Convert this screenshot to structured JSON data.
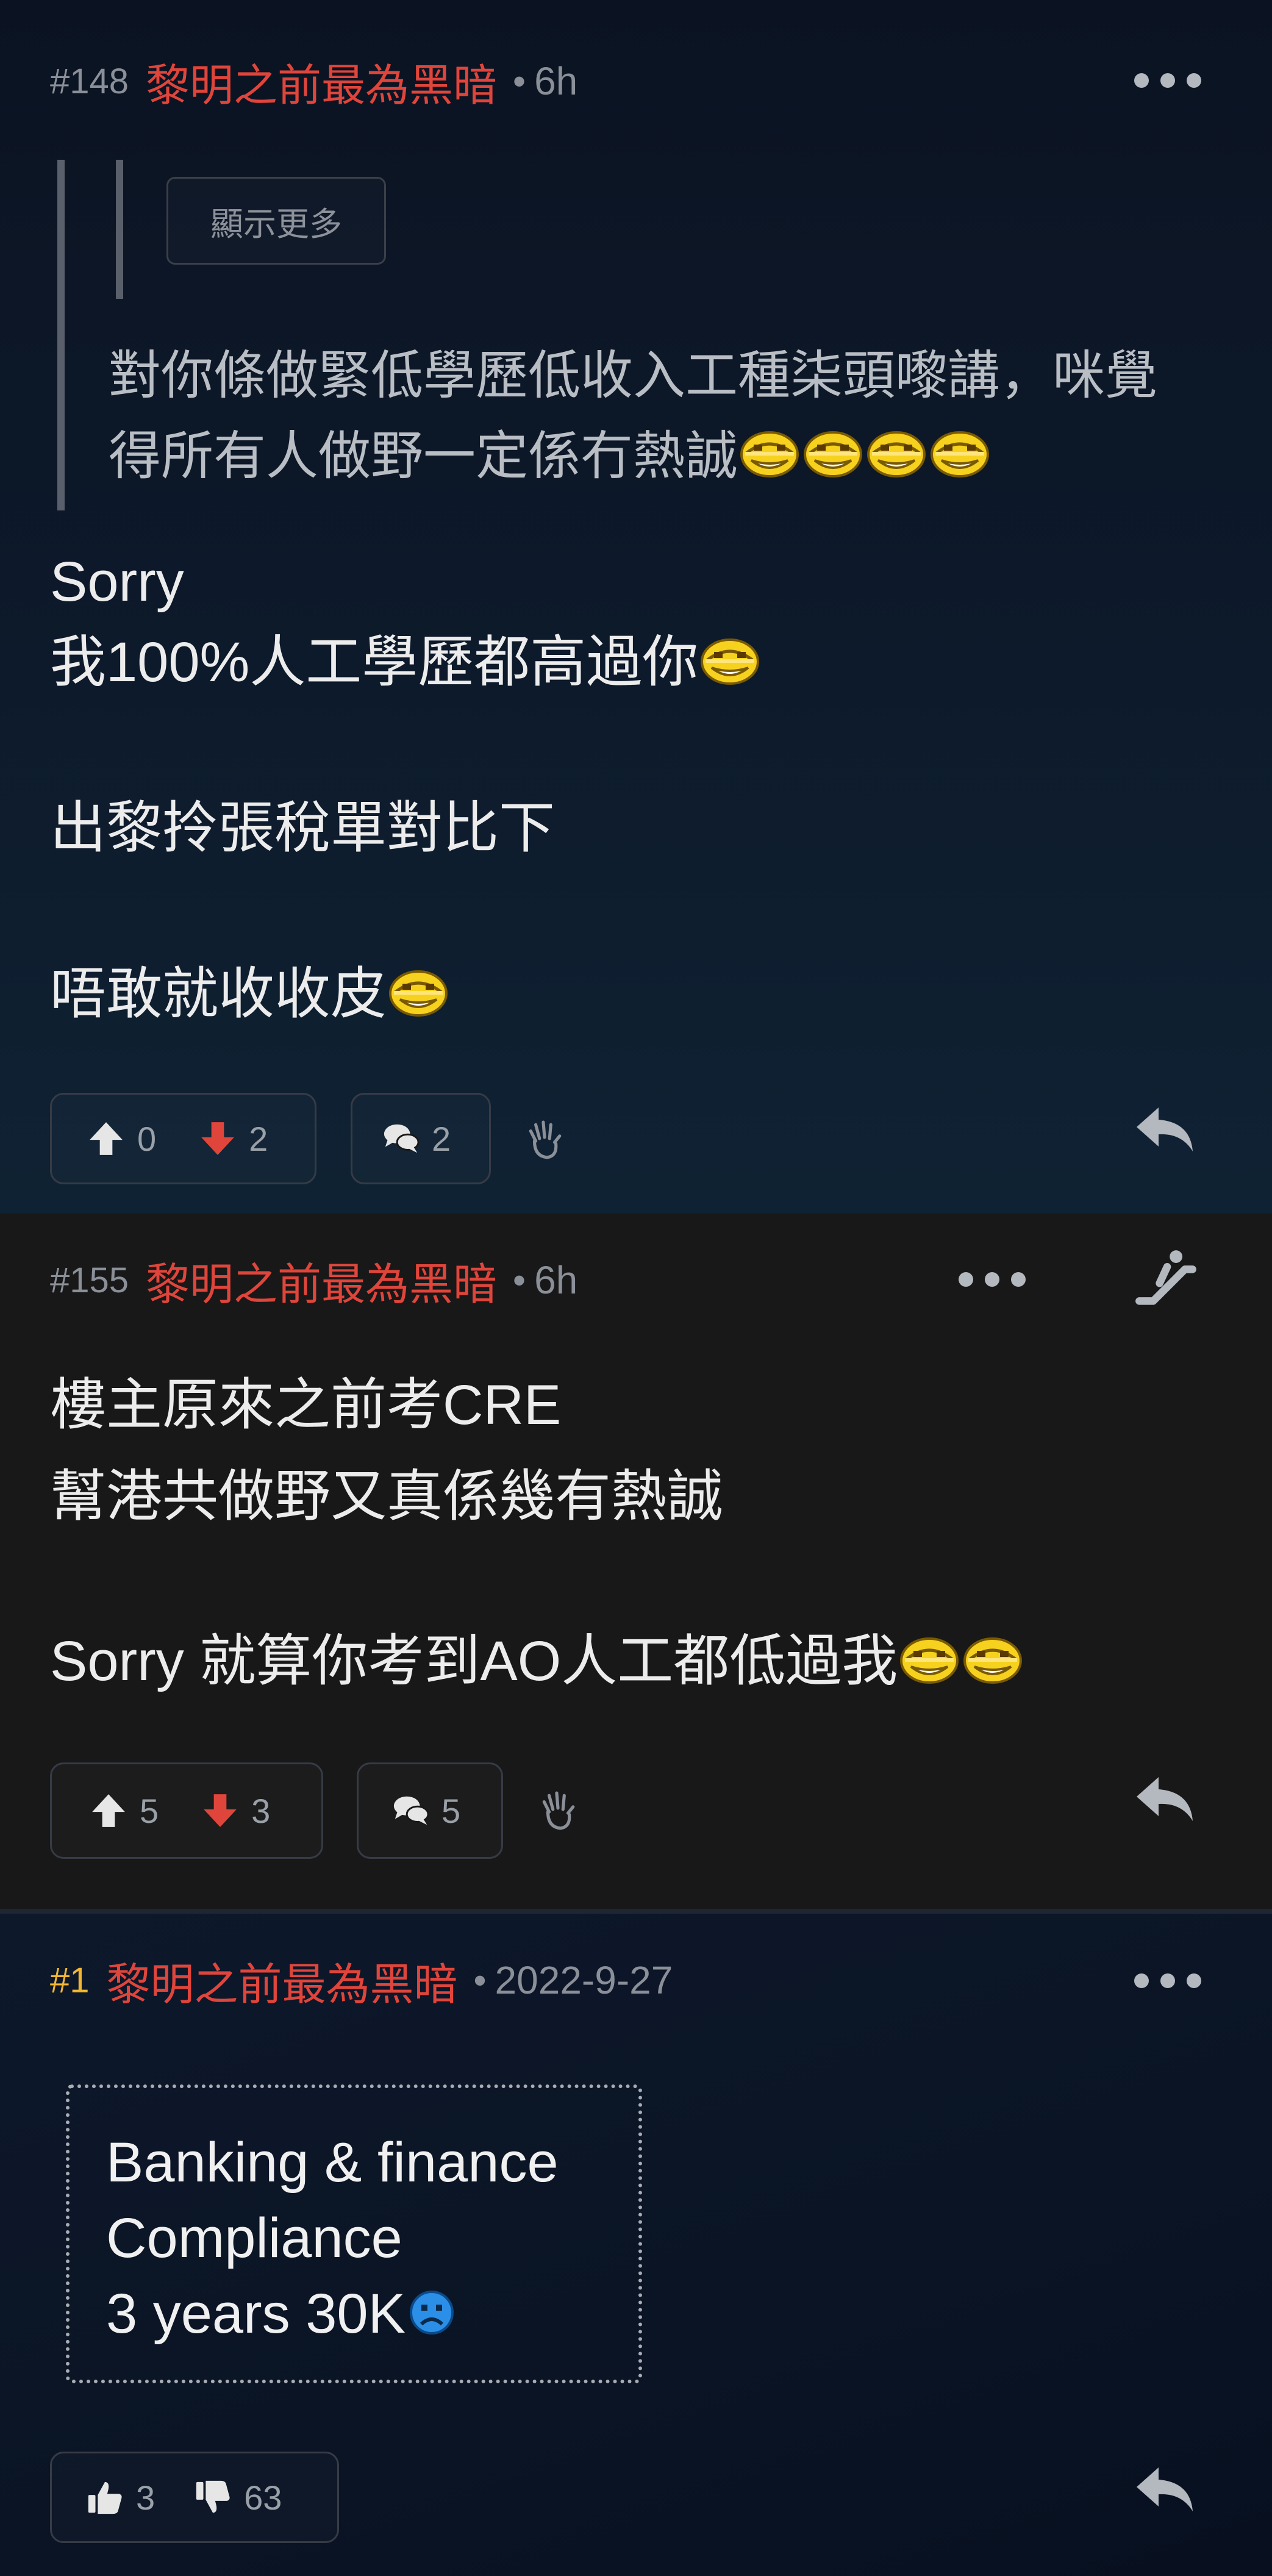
{
  "posts": [
    {
      "floor": "#148",
      "author": "黎明之前最為黑暗",
      "time": "6h",
      "quote": {
        "show_more": "顯示更多",
        "line1": "對你條做緊低學歷低收入工種柒頭嚟講，咪覺",
        "line2": "得所有人做野一定係冇熱誠"
      },
      "lines": [
        "Sorry",
        "我100%人工學歷都高過你",
        "出黎拎張稅單對比下",
        "唔敢就收收皮"
      ],
      "upvotes": "0",
      "downvotes": "2",
      "comments": "2"
    },
    {
      "floor": "#155",
      "author": "黎明之前最為黑暗",
      "time": "6h",
      "lines": [
        "樓主原來之前考CRE",
        "幫港共做野又真係幾有熱誠",
        "Sorry 就算你考到AO人工都低過我"
      ],
      "upvotes": "5",
      "downvotes": "3",
      "comments": "5"
    },
    {
      "floor": "#1",
      "author": "黎明之前最為黑暗",
      "time": "2022-9-27",
      "box_lines": [
        "Banking & finance",
        "Compliance",
        "3 years 30K"
      ],
      "likes": "3",
      "dislikes": "63"
    }
  ],
  "colors": {
    "author": "#e0453b",
    "op_floor": "#f2b632",
    "upvote": "#e0453b",
    "muted": "#8a8f98"
  },
  "icons": [
    "more-icon",
    "arrow-up-icon",
    "arrow-down-icon",
    "comment-icon",
    "hand-icon",
    "reply-icon",
    "escalator-icon",
    "thumb-up-icon",
    "thumb-down-icon",
    "emoji-icon"
  ]
}
